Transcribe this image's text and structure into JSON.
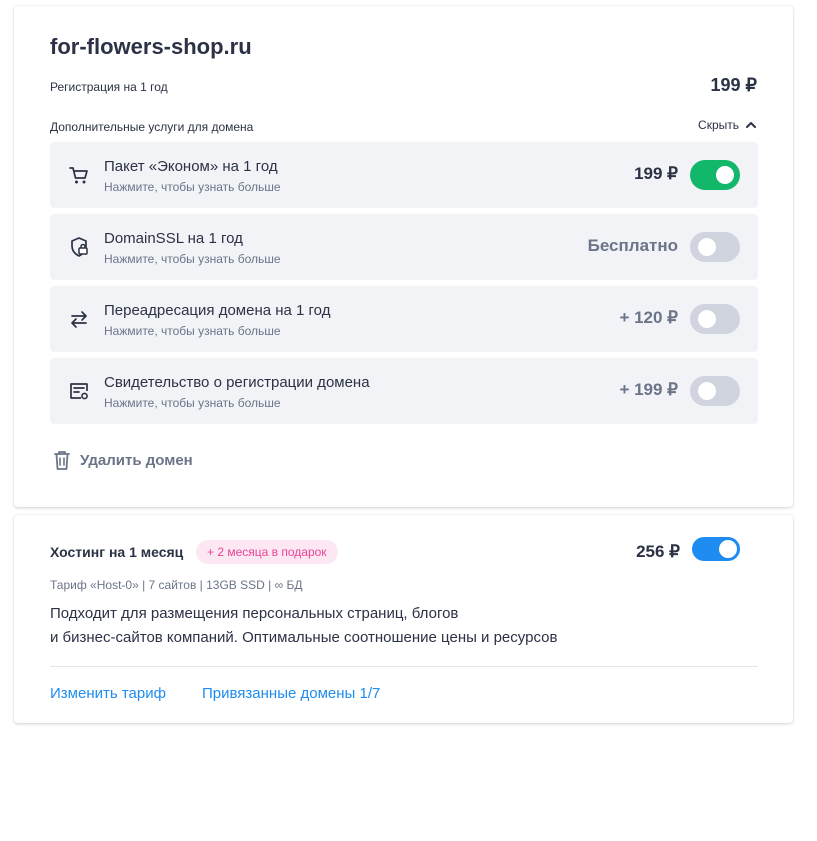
{
  "domain": {
    "name": "for-flowers-shop.ru",
    "registration_label": "Регистрация на 1 год",
    "registration_price": "199 ₽",
    "extras_label": "Дополнительные услуги для домена",
    "hide_label": "Скрыть",
    "services": [
      {
        "title": "Пакет «Эконом» на 1 год",
        "subtitle": "Нажмите, чтобы узнать больше",
        "price": "199 ₽",
        "enabled": true,
        "icon": "cart-icon"
      },
      {
        "title": "DomainSSL на 1 год",
        "subtitle": "Нажмите, чтобы узнать больше",
        "price": "Бесплатно",
        "enabled": false,
        "icon": "ssl-shield-icon"
      },
      {
        "title": "Переадресация домена на 1 год",
        "subtitle": "Нажмите, чтобы узнать больше",
        "price": "+ 120 ₽",
        "enabled": false,
        "icon": "redirect-arrows-icon"
      },
      {
        "title": "Свидетельство о регистрации домена",
        "subtitle": "Нажмите, чтобы узнать больше",
        "price": "+ 199 ₽",
        "enabled": false,
        "icon": "certificate-icon"
      }
    ],
    "delete_label": "Удалить домен"
  },
  "hosting": {
    "title": "Хостинг на 1 месяц",
    "gift_badge": "+ 2 месяца в подарок",
    "price": "256 ₽",
    "enabled": true,
    "tariff_line": "Тариф «Host-0» | 7 сайтов | 13GB SSD | ∞ БД",
    "description_line1": "Подходит для размещения персональных страниц, блогов",
    "description_line2": "и бизнес-сайтов компаний. Оптимальные соотношение цены и ресурсов",
    "change_tariff_link": "Изменить тариф",
    "linked_domains_link": "Привязанные домены 1/7"
  },
  "colors": {
    "toggle_on_green": "#12b76a",
    "toggle_on_blue": "#1e8cf0",
    "toggle_off": "#cfd4de",
    "badge_bg": "#fde7f3",
    "badge_text": "#e94597",
    "link": "#1e8cf0"
  }
}
